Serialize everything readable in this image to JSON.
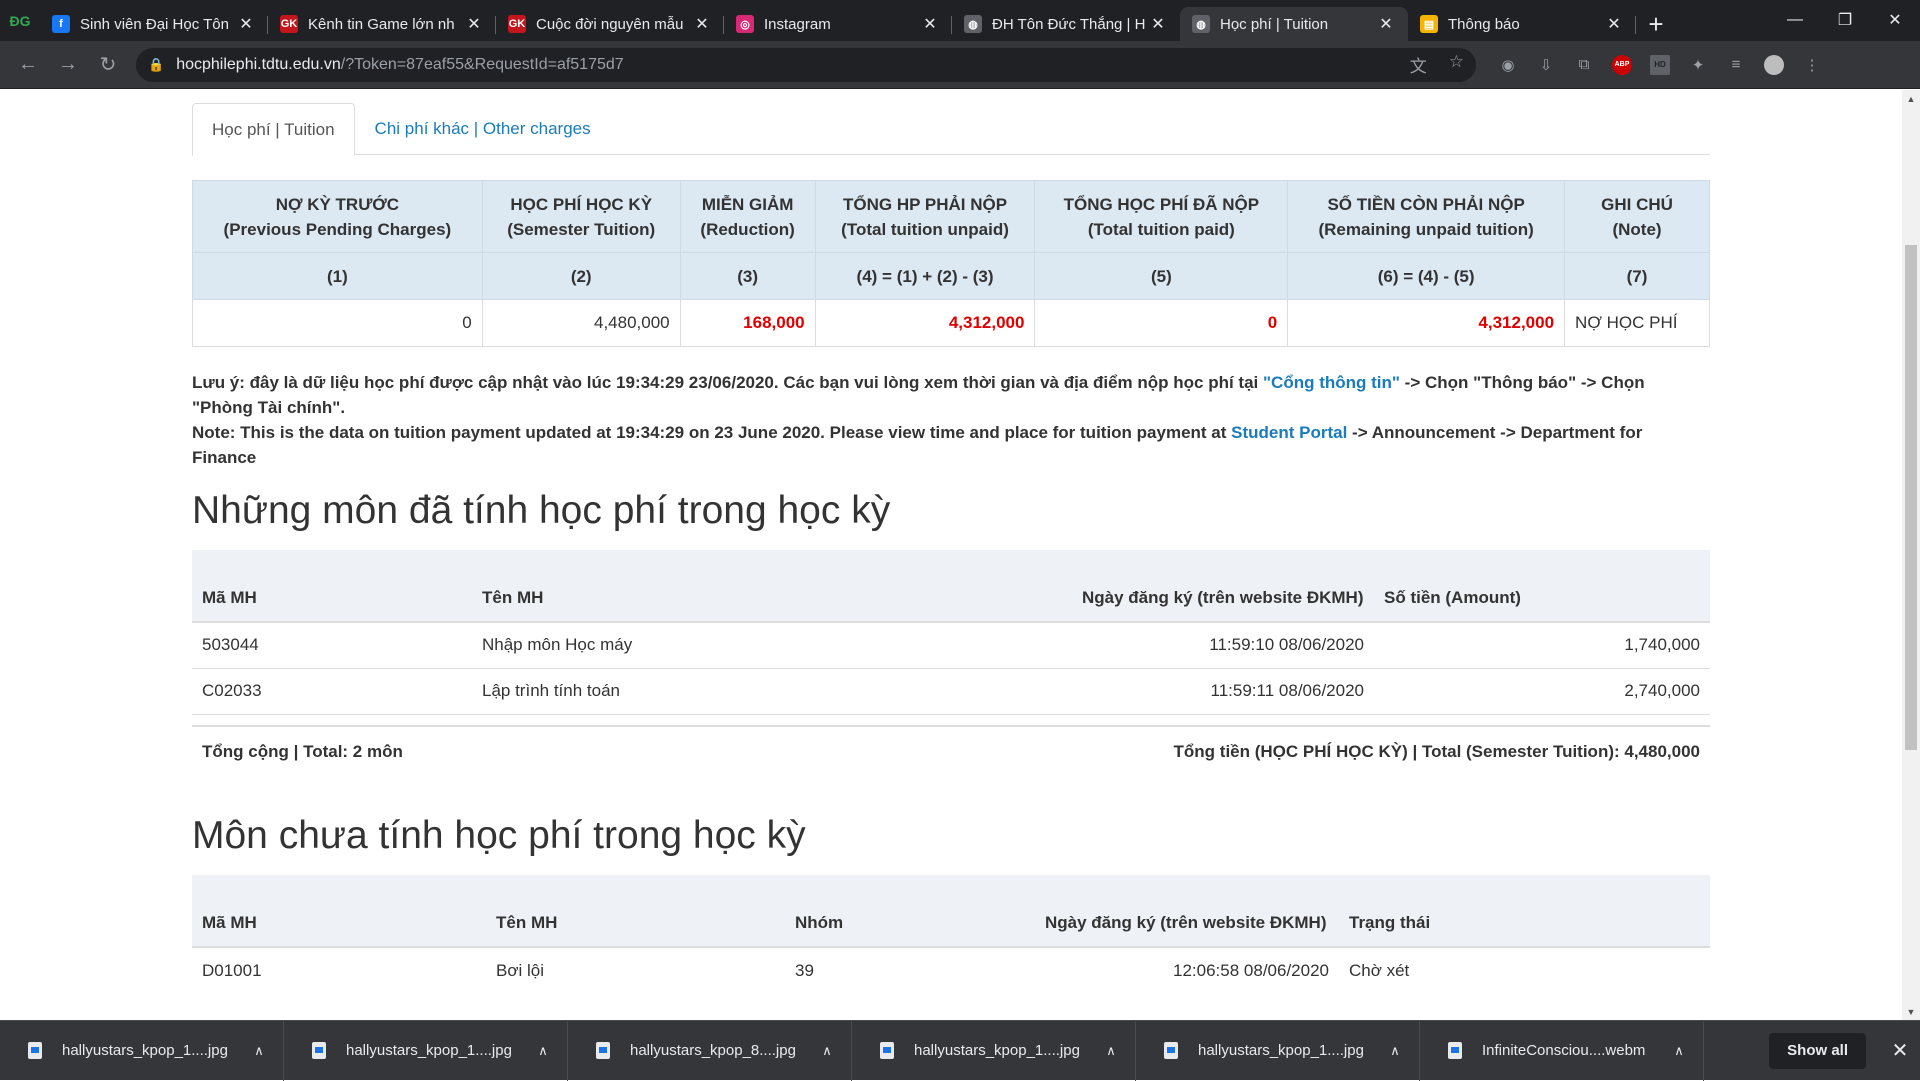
{
  "browser": {
    "pinned_tab_label": "ĐG",
    "tabs": [
      {
        "title": "Sinh viên Đại Học Tôn",
        "favicon": "facebook-icon",
        "color": "#1877f2",
        "glyph": "f"
      },
      {
        "title": "Kênh tin Game lớn nh",
        "favicon": "gamek-icon",
        "color": "#c4161c",
        "glyph": "GK"
      },
      {
        "title": "Cuộc đời nguyên mẫu",
        "favicon": "gamek-icon",
        "color": "#c4161c",
        "glyph": "GK"
      },
      {
        "title": "Instagram",
        "favicon": "instagram-icon",
        "color": "#d62976",
        "glyph": "◎"
      },
      {
        "title": "ĐH Tôn Đức Thắng | H",
        "favicon": "globe-icon",
        "color": "#5f6368",
        "glyph": "◍"
      },
      {
        "title": "Học phí | Tuition",
        "favicon": "globe-icon",
        "color": "#5f6368",
        "glyph": "◍"
      },
      {
        "title": "Thông báo",
        "favicon": "notice-icon",
        "color": "#f4b400",
        "glyph": "▤"
      }
    ],
    "active_tab": 5,
    "url_host": "hocphilephi.tdtu.edu.vn",
    "url_path": "/?Token=87eaf55&RequestId=af5175d7"
  },
  "page": {
    "tabs": {
      "tuition": "Học phí | Tuition",
      "other": "Chi phí khác | Other charges"
    },
    "fee_table": {
      "headers": [
        {
          "vi": "NỢ KỲ TRƯỚC",
          "en": "(Previous Pending Charges)",
          "formula": "(1)"
        },
        {
          "vi": "HỌC PHÍ HỌC KỲ",
          "en": "(Semester Tuition)",
          "formula": "(2)"
        },
        {
          "vi": "MIỄN GIẢM",
          "en": "(Reduction)",
          "formula": "(3)"
        },
        {
          "vi": "TỔNG HP PHẢI NỘP",
          "en": "(Total tuition unpaid)",
          "formula": "(4) = (1) + (2) - (3)"
        },
        {
          "vi": "TỔNG HỌC PHÍ ĐÃ NỘP",
          "en": "(Total tuition paid)",
          "formula": "(5)"
        },
        {
          "vi": "SỐ TIỀN CÒN PHẢI NỘP",
          "en": "(Remaining unpaid tuition)",
          "formula": "(6) = (4) - (5)"
        },
        {
          "vi": "GHI CHÚ",
          "en": "(Note)",
          "formula": "(7)"
        }
      ],
      "values": [
        "0",
        "4,480,000",
        "168,000",
        "4,312,000",
        "0",
        "4,312,000",
        "NỢ HỌC PHÍ"
      ]
    },
    "notice": {
      "vi_part1": "Lưu ý: đây là dữ liệu học phí được cập nhật vào lúc 19:34:29 23/06/2020. Các bạn vui lòng xem thời gian và địa điểm nộp học phí tại ",
      "vi_link": "\"Cổng thông tin\"",
      "vi_part2": " -> Chọn \"Thông báo\" -> Chọn \"Phòng Tài chính\".",
      "en_part1": "Note: This is the data on tuition payment updated at 19:34:29 on 23 June 2020. Please view time and place for tuition payment at ",
      "en_link": "Student Portal",
      "en_part2": " -> Announcement -> Department for Finance"
    },
    "charged": {
      "title": "Những môn đã tính học phí trong học kỳ",
      "headers": {
        "code": "Mã MH",
        "name": "Tên MH",
        "date": "Ngày đăng ký (trên website ĐKMH)",
        "amount": "Số tiền (Amount)"
      },
      "rows": [
        {
          "code": "503044",
          "name": "Nhập môn Học máy",
          "date": "11:59:10 08/06/2020",
          "amount": "1,740,000"
        },
        {
          "code": "C02033",
          "name": "Lập trình tính toán",
          "date": "11:59:11 08/06/2020",
          "amount": "2,740,000"
        }
      ],
      "total_left": "Tổng cộng | Total: 2 môn",
      "total_right": "Tổng tiền (HỌC PHÍ HỌC KỲ) | Total (Semester Tuition): 4,480,000"
    },
    "uncharged": {
      "title": "Môn chưa tính học phí trong học kỳ",
      "headers": {
        "code": "Mã MH",
        "name": "Tên MH",
        "group": "Nhóm",
        "date": "Ngày đăng ký (trên website ĐKMH)",
        "status": "Trạng thái"
      },
      "rows": [
        {
          "code": "D01001",
          "name": "Bơi lội",
          "group": "39",
          "date": "12:06:58 08/06/2020",
          "status": "Chờ xét"
        }
      ]
    }
  },
  "downloads": {
    "items": [
      "hallyustars_kpop_1....jpg",
      "hallyustars_kpop_1....jpg",
      "hallyustars_kpop_8....jpg",
      "hallyustars_kpop_1....jpg",
      "hallyustars_kpop_1....jpg",
      "InfiniteConsciou....webm"
    ],
    "show_all": "Show all"
  }
}
